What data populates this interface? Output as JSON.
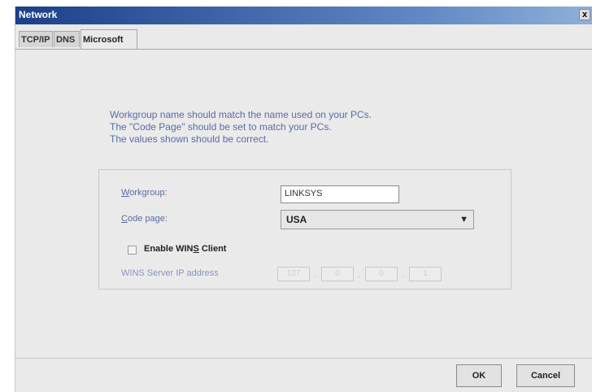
{
  "window": {
    "title": "Network",
    "close_label": "x"
  },
  "tabs": [
    {
      "label": "TCP/IP",
      "active": false
    },
    {
      "label": "DNS",
      "active": false
    },
    {
      "label": "Microsoft",
      "active": true
    }
  ],
  "info_lines": [
    "Workgroup name should match the name used on your PCs.",
    "The \"Code Page\" should be set to match your PCs.",
    "The values shown should be correct."
  ],
  "form": {
    "workgroup_label_u": "W",
    "workgroup_label_rest": "orkgroup:",
    "workgroup_value": "LINKSYS",
    "codepage_label_u": "C",
    "codepage_label_rest": "ode page:",
    "codepage_value": "USA",
    "wins_label_pre": "Enable WIN",
    "wins_label_u": "S",
    "wins_label_post": " Client",
    "wins_enabled": false,
    "wins_ip_label": "WINS Server IP address",
    "wins_ip": [
      "127",
      "0",
      "0",
      "1"
    ]
  },
  "buttons": {
    "ok": "OK",
    "cancel": "Cancel"
  }
}
